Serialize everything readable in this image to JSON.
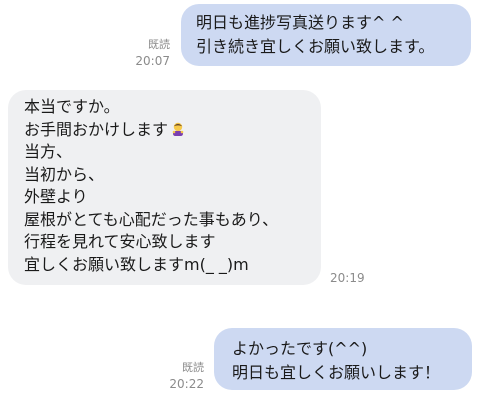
{
  "messages": [
    {
      "side": "sent",
      "lines": [
        "明日も進捗写真送ります^ ^",
        "引き続き宜しくお願い致します。"
      ],
      "read_label": "既読",
      "time": "20:07"
    },
    {
      "side": "received",
      "lines": [
        "本当ですか。",
        "お手間おかけします",
        "当方、",
        "当初から、",
        "外壁より",
        "屋根がとても心配だった事もあり、",
        "行程を見れて安心致します",
        "宜しくお願い致しますm(_ _)m"
      ],
      "emoji": "bowing-person-icon",
      "time": "20:19"
    },
    {
      "side": "sent",
      "lines": [
        "よかったです(^^)",
        "明日も宜しくお願いします！"
      ],
      "read_label": "既読",
      "time": "20:22"
    }
  ],
  "colors": {
    "sent_bubble": "#cdd9f2",
    "received_bubble": "#eff0f2",
    "meta_text": "#8b8b8b"
  }
}
